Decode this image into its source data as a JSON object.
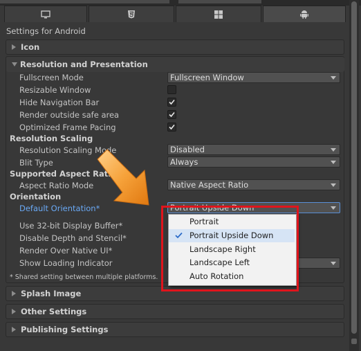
{
  "tabs": [
    {
      "icon": "monitor-icon"
    },
    {
      "icon": "html5-icon"
    },
    {
      "icon": "windows-icon"
    },
    {
      "icon": "android-icon",
      "active": true
    }
  ],
  "settings_title": "Settings for Android",
  "sections": {
    "icon": "Icon",
    "resolution": "Resolution and Presentation",
    "splash": "Splash Image",
    "other": "Other Settings",
    "publishing": "Publishing Settings"
  },
  "rows": {
    "fullscreen_mode": {
      "label": "Fullscreen Mode",
      "value": "Fullscreen Window"
    },
    "resizable_window": {
      "label": "Resizable Window",
      "checked": false
    },
    "hide_nav_bar": {
      "label": "Hide Navigation Bar",
      "checked": true
    },
    "render_outside": {
      "label": "Render outside safe area",
      "checked": true
    },
    "optimized_pacing": {
      "label": "Optimized Frame Pacing",
      "checked": true
    },
    "resolution_scaling_header": "Resolution Scaling",
    "resolution_scaling_mode": {
      "label": "Resolution Scaling Mode",
      "value": "Disabled"
    },
    "blit_type": {
      "label": "Blit Type",
      "value": "Always"
    },
    "supported_aspect_header": "Supported Aspect Ratio",
    "aspect_ratio_mode": {
      "label": "Aspect Ratio Mode",
      "value": "Native Aspect Ratio"
    },
    "orientation_header": "Orientation",
    "default_orientation": {
      "label": "Default Orientation*",
      "value": "Portrait Upside Down"
    },
    "use_32bit": {
      "label": "Use 32-bit Display Buffer*"
    },
    "disable_depth": {
      "label": "Disable Depth and Stencil*"
    },
    "render_over_native": {
      "label": "Render Over Native UI*"
    },
    "show_loading": {
      "label": "Show Loading Indicator"
    },
    "shared_note": "* Shared setting between multiple platforms."
  },
  "orientation_options": [
    {
      "label": "Portrait",
      "selected": false
    },
    {
      "label": "Portrait Upside Down",
      "selected": true
    },
    {
      "label": "Landscape Right",
      "selected": false
    },
    {
      "label": "Landscape Left",
      "selected": false
    },
    {
      "label": "Auto Rotation",
      "selected": false
    }
  ],
  "colors": {
    "highlight_box": "#e0141c",
    "arrow": "#f08a1c",
    "accent_label": "#6aa9f5"
  }
}
